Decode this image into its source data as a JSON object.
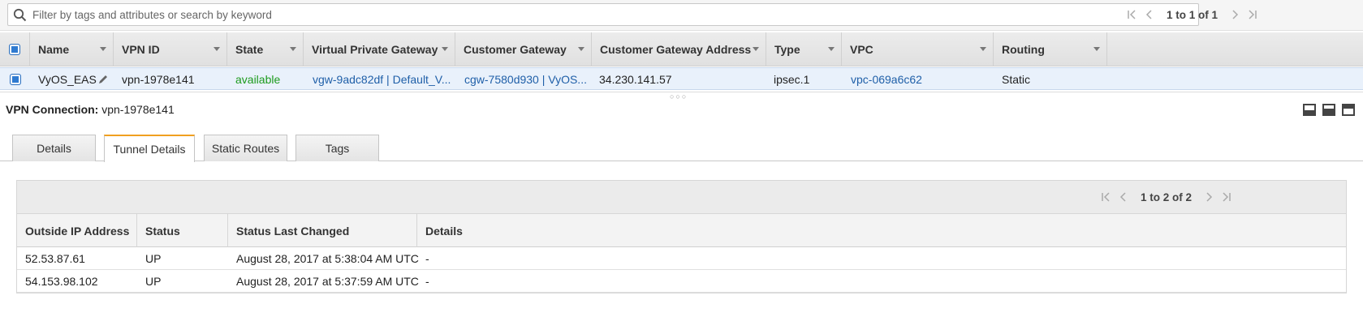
{
  "filter": {
    "placeholder": "Filter by tags and attributes or search by keyword",
    "pagination": "1 to 1 of 1"
  },
  "table": {
    "columns": [
      "Name",
      "VPN ID",
      "State",
      "Virtual Private Gateway",
      "Customer Gateway",
      "Customer Gateway Address",
      "Type",
      "VPC",
      "Routing"
    ],
    "rows": [
      {
        "name": "VyOS_EAS",
        "vpn_id": "vpn-1978e141",
        "state": "available",
        "vpg": "vgw-9adc82df | Default_V...",
        "cgw": "cgw-7580d930 | VyOS...",
        "cgw_address": "34.230.141.57",
        "type": "ipsec.1",
        "vpc": "vpc-069a6c62",
        "routing": "Static"
      }
    ]
  },
  "detail": {
    "label": "VPN Connection:",
    "value": "vpn-1978e141",
    "tabs": [
      "Details",
      "Tunnel Details",
      "Static Routes",
      "Tags"
    ],
    "active_tab": "Tunnel Details"
  },
  "tunnels": {
    "pagination": "1 to 2 of 2",
    "columns": [
      "Outside IP Address",
      "Status",
      "Status Last Changed",
      "Details"
    ],
    "rows": [
      {
        "ip": "52.53.87.61",
        "status": "UP",
        "changed": "August 28, 2017 at 5:38:04 AM UTC",
        "details": "-"
      },
      {
        "ip": "54.153.98.102",
        "status": "UP",
        "changed": "August 28, 2017 at 5:37:59 AM UTC",
        "details": "-"
      }
    ]
  },
  "colors": {
    "link": "#1f5fa8",
    "status_ok": "#1d9b1d",
    "active_tab_accent": "#f0a020",
    "selection": "#2f7ad0"
  }
}
